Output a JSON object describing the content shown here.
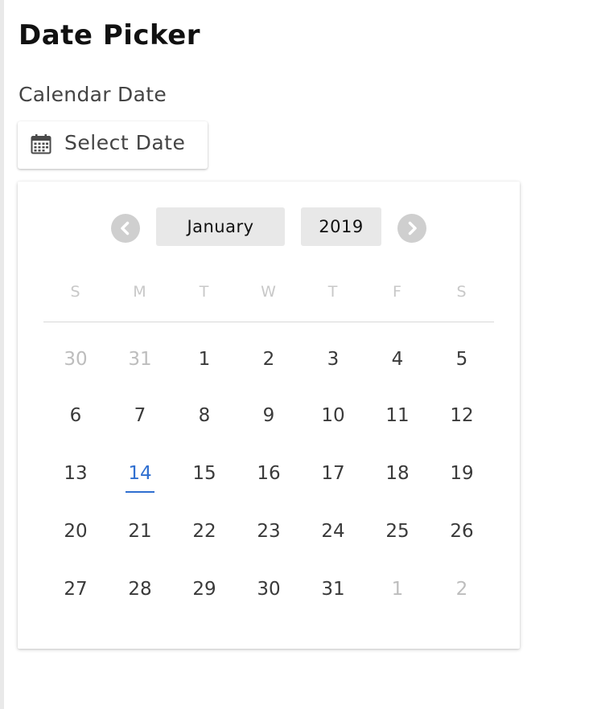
{
  "page": {
    "title": "Date Picker",
    "field_label": "Calendar Date"
  },
  "select_button": {
    "label": "Select Date",
    "icon": "calendar-icon"
  },
  "calendar": {
    "month": "January",
    "year": "2019",
    "prev_icon": "chevron-left-icon",
    "next_icon": "chevron-right-icon",
    "weekdays": [
      "S",
      "M",
      "T",
      "W",
      "T",
      "F",
      "S"
    ],
    "weeks": [
      [
        {
          "d": "30",
          "m": true
        },
        {
          "d": "31",
          "m": true
        },
        {
          "d": "1"
        },
        {
          "d": "2"
        },
        {
          "d": "3"
        },
        {
          "d": "4"
        },
        {
          "d": "5"
        }
      ],
      [
        {
          "d": "6"
        },
        {
          "d": "7"
        },
        {
          "d": "8"
        },
        {
          "d": "9"
        },
        {
          "d": "10"
        },
        {
          "d": "11"
        },
        {
          "d": "12"
        }
      ],
      [
        {
          "d": "13"
        },
        {
          "d": "14",
          "today": true
        },
        {
          "d": "15"
        },
        {
          "d": "16"
        },
        {
          "d": "17"
        },
        {
          "d": "18"
        },
        {
          "d": "19"
        }
      ],
      [
        {
          "d": "20"
        },
        {
          "d": "21"
        },
        {
          "d": "22"
        },
        {
          "d": "23"
        },
        {
          "d": "24"
        },
        {
          "d": "25"
        },
        {
          "d": "26"
        }
      ],
      [
        {
          "d": "27"
        },
        {
          "d": "28"
        },
        {
          "d": "29"
        },
        {
          "d": "30"
        },
        {
          "d": "31"
        },
        {
          "d": "1",
          "m": true
        },
        {
          "d": "2",
          "m": true
        }
      ]
    ]
  },
  "colors": {
    "accent": "#2f6fd0",
    "muted_text": "#bdbdbd",
    "selector_bg": "#e8e8e8",
    "nav_bg": "#cfcfcf"
  }
}
